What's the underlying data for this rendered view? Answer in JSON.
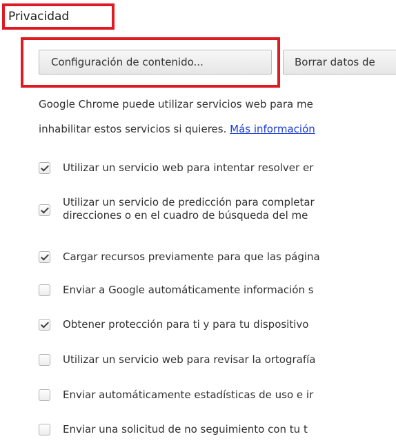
{
  "privacy": {
    "title": "Privacidad",
    "buttons": {
      "content_settings": "Configuración de contenido...",
      "clear_browsing": "Borrar datos de"
    },
    "description": {
      "line1": "Google Chrome puede utilizar servicios web para me",
      "line2": "inhabilitar estos servicios si quieres.",
      "link": "Más información"
    },
    "options": [
      {
        "label": "Utilizar un servicio web para intentar resolver er",
        "checked": true
      },
      {
        "label": "Utilizar un servicio de predicción para completar",
        "label2": "direcciones o en el cuadro de búsqueda del me",
        "checked": true
      },
      {
        "label": "Cargar recursos previamente para que las página",
        "checked": true
      },
      {
        "label": "Enviar a Google automáticamente información s",
        "checked": false
      },
      {
        "label": "Obtener protección para ti y para tu dispositivo",
        "checked": true
      },
      {
        "label": "Utilizar un servicio web para revisar la ortografía",
        "checked": false
      },
      {
        "label": "Enviar automáticamente estadísticas de uso e ir",
        "checked": false
      },
      {
        "label": "Enviar una solicitud de no seguimiento con tu t",
        "checked": false
      }
    ]
  },
  "colors": {
    "highlight": "#e01a22",
    "link": "#1a3ed8"
  }
}
